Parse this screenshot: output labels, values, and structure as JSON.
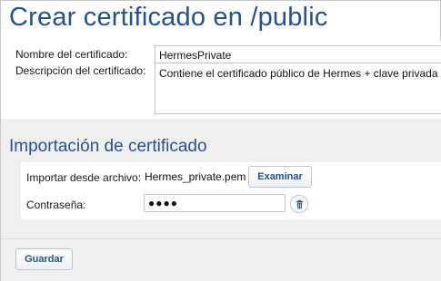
{
  "page": {
    "title": "Crear certificado en /public"
  },
  "certificate": {
    "name_label": "Nombre del certificado:",
    "name_value": "HermesPrivate",
    "description_label": "Descripción del certificado:",
    "description_value": "Contiene el certificado público de Hermes + clave privada"
  },
  "import": {
    "section_title": "Importación de certificado",
    "file_label": "Importar desde archivo:",
    "file_name": "Hermes_private.pem",
    "browse_label": "Examinar",
    "password_label": "Contraseña:",
    "password_value": "●●●●",
    "clear_icon": "trash-icon"
  },
  "footer": {
    "save_label": "Guardar"
  },
  "colors": {
    "accent": "#27518b",
    "band": "#efefef"
  }
}
